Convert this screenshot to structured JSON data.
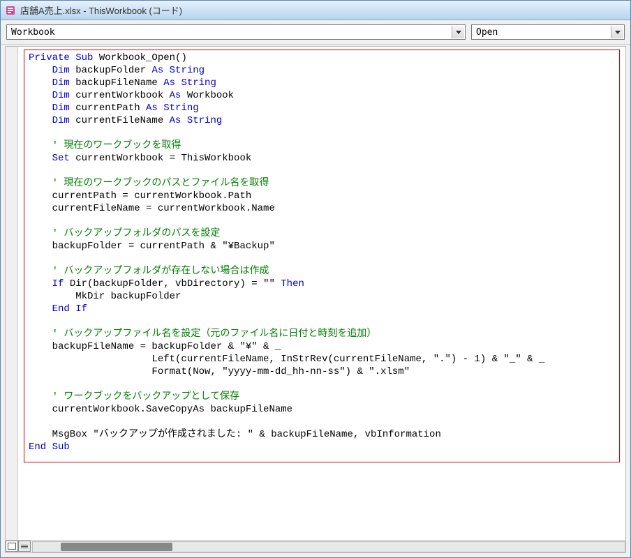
{
  "titlebar": {
    "text": "店舗A売上.xlsx - ThisWorkbook (コード)"
  },
  "dropdown_left": {
    "value": "Workbook"
  },
  "dropdown_right": {
    "value": "Open"
  },
  "code": {
    "l1a": "Private Sub",
    "l1b": " Workbook_Open()",
    "l2a": "    Dim",
    "l2b": " backupFolder ",
    "l2c": "As String",
    "l3a": "    Dim",
    "l3b": " backupFileName ",
    "l3c": "As String",
    "l4a": "    Dim",
    "l4b": " currentWorkbook ",
    "l4c": "As",
    "l4d": " Workbook",
    "l5a": "    Dim",
    "l5b": " currentPath ",
    "l5c": "As String",
    "l6a": "    Dim",
    "l6b": " currentFileName ",
    "l6c": "As String",
    "l7": "    ",
    "l8": "    ' 現在のワークブックを取得",
    "l9a": "    Set",
    "l9b": " currentWorkbook = ThisWorkbook",
    "l10": "    ",
    "l11": "    ' 現在のワークブックのパスとファイル名を取得",
    "l12": "    currentPath = currentWorkbook.Path",
    "l13": "    currentFileName = currentWorkbook.Name",
    "l14": "    ",
    "l15": "    ' バックアップフォルダのパスを設定",
    "l16": "    backupFolder = currentPath & \"¥Backup\"",
    "l17": "    ",
    "l18": "    ' バックアップフォルダが存在しない場合は作成",
    "l19a": "    If",
    "l19b": " Dir(backupFolder, vbDirectory) = \"\" ",
    "l19c": "Then",
    "l20": "        MkDir backupFolder",
    "l21a": "    End If",
    "l22": "    ",
    "l23": "    ' バックアップファイル名を設定（元のファイル名に日付と時刻を追加）",
    "l24": "    backupFileName = backupFolder & \"¥\" & _",
    "l25": "                     Left(currentFileName, InStrRev(currentFileName, \".\") - 1) & \"_\" & _",
    "l26": "                     Format(Now, \"yyyy-mm-dd_hh-nn-ss\") & \".xlsm\"",
    "l27": "    ",
    "l28": "    ' ワークブックをバックアップとして保存",
    "l29": "    currentWorkbook.SaveCopyAs backupFileName",
    "l30": "    ",
    "l31": "    MsgBox \"バックアップが作成されました: \" & backupFileName, vbInformation",
    "l32": "End Sub"
  }
}
